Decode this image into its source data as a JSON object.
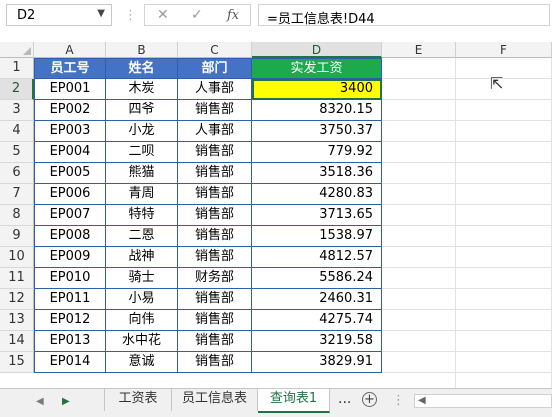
{
  "formula_bar": {
    "name_box": "D2",
    "cancel_icon": "✕",
    "enter_icon": "✓",
    "fx_label": "fx",
    "formula": "=员工信息表!D44"
  },
  "columns": [
    "A",
    "B",
    "C",
    "D",
    "E",
    "F"
  ],
  "row_numbers": [
    "1",
    "2",
    "3",
    "4",
    "5",
    "6",
    "7",
    "8",
    "9",
    "10",
    "11",
    "12",
    "13",
    "14",
    "15"
  ],
  "table": {
    "headers": [
      "员工号",
      "姓名",
      "部门",
      "实发工资"
    ],
    "rows": [
      [
        "EP001",
        "木炭",
        "人事部",
        "3400"
      ],
      [
        "EP002",
        "四爷",
        "销售部",
        "8320.15"
      ],
      [
        "EP003",
        "小龙",
        "人事部",
        "3750.37"
      ],
      [
        "EP004",
        "二呗",
        "销售部",
        "779.92"
      ],
      [
        "EP005",
        "熊猫",
        "销售部",
        "3518.36"
      ],
      [
        "EP006",
        "青周",
        "销售部",
        "4280.83"
      ],
      [
        "EP007",
        "特特",
        "销售部",
        "3713.65"
      ],
      [
        "EP008",
        "二恩",
        "销售部",
        "1538.97"
      ],
      [
        "EP009",
        "战神",
        "销售部",
        "4812.57"
      ],
      [
        "EP010",
        "骑士",
        "财务部",
        "5586.24"
      ],
      [
        "EP011",
        "小易",
        "销售部",
        "2460.31"
      ],
      [
        "EP012",
        "向伟",
        "销售部",
        "4275.74"
      ],
      [
        "EP013",
        "水中花",
        "销售部",
        "3219.58"
      ],
      [
        "EP014",
        "意诚",
        "销售部",
        "3829.91"
      ]
    ]
  },
  "sheet_tabs": {
    "tabs": [
      "工资表",
      "员工信息表",
      "查询表1"
    ],
    "active": "查询表1",
    "more": "...",
    "add": "+"
  },
  "colors": {
    "header_blue": "#4472c4",
    "header_green": "#1daa4c",
    "highlight_yellow": "#ffff00",
    "excel_green": "#217346"
  }
}
